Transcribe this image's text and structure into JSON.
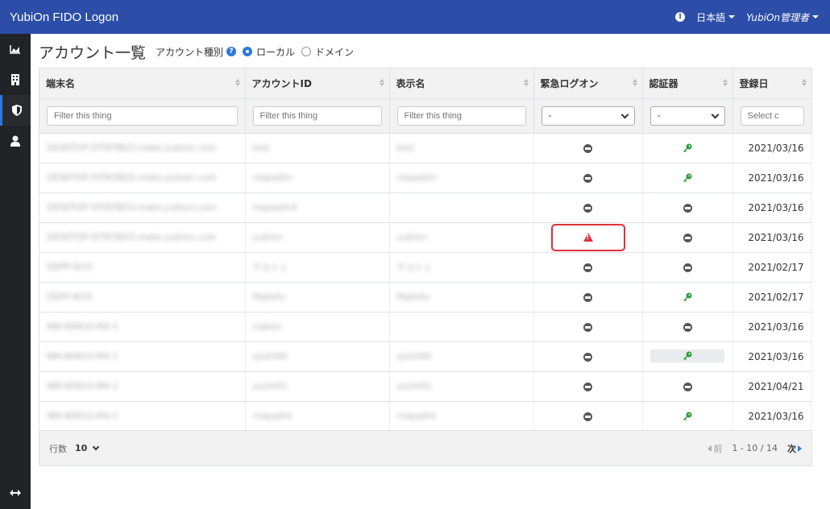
{
  "app": {
    "title": "YubiOn FIDO Logon"
  },
  "nav": {
    "language": "日本語",
    "user": "YubiOn管理者"
  },
  "sidebar": {
    "items": [
      {
        "icon": "chart-area-icon"
      },
      {
        "icon": "building-icon"
      },
      {
        "icon": "shield-icon",
        "active": true
      },
      {
        "icon": "user-icon"
      }
    ],
    "toggle_icon": "arrows-h-icon"
  },
  "page": {
    "title": "アカウント一覧",
    "account_type_label": "アカウント種別",
    "radio_local": "ローカル",
    "radio_domain": "ドメイン"
  },
  "table": {
    "headers": [
      "端末名",
      "アカウントID",
      "表示名",
      "緊急ログオン",
      "認証器",
      "登録日"
    ],
    "filter_placeholders": [
      "Filter this thing",
      "Filter this thing",
      "Filter this thing"
    ],
    "filter_select_values": [
      "-",
      "-"
    ],
    "date_placeholder": "Select c",
    "rows": [
      {
        "terminal": "DESKTOP-5ITNTBD3.mako.yubion.com",
        "account_id": "test",
        "display": "test",
        "emergency": "minus",
        "auth": "key",
        "date": "2021/03/16"
      },
      {
        "terminal": "DESKTOP-5ITNTBD3.mako.yubion.com",
        "account_id": "mapadm",
        "display": "mapadm",
        "emergency": "minus",
        "auth": "key",
        "date": "2021/03/16"
      },
      {
        "terminal": "DESKTOP-5ITNTBD3.mako.yubion.com",
        "account_id": "mapadm5",
        "display": "",
        "emergency": "minus",
        "auth": "minus",
        "date": "2021/03/16"
      },
      {
        "terminal": "DESKTOP-5ITNTBD3.mako.yubion.com",
        "account_id": "yubion",
        "display": "yubion",
        "emergency": "warning",
        "auth": "minus",
        "date": "2021/03/16"
      },
      {
        "terminal": "DEPP-W10",
        "account_id": "テスト１",
        "display": "テスト１",
        "emergency": "minus",
        "auth": "minus",
        "date": "2021/02/17"
      },
      {
        "terminal": "DEPP-W10",
        "account_id": "Makoto",
        "display": "Makoto",
        "emergency": "minus",
        "auth": "key",
        "date": "2021/02/17"
      },
      {
        "terminal": "NM-WIN10-M4-1",
        "account_id": "makos",
        "display": "",
        "emergency": "minus",
        "auth": "minus",
        "date": "2021/03/16"
      },
      {
        "terminal": "NM-WIN10-M4-1",
        "account_id": "yoshi00",
        "display": "yoshi00",
        "emergency": "minus",
        "auth": "key-highlight",
        "date": "2021/03/16"
      },
      {
        "terminal": "NM-WIN10-M4-1",
        "account_id": "yoshi01",
        "display": "yoshi01",
        "emergency": "minus",
        "auth": "minus",
        "date": "2021/04/21"
      },
      {
        "terminal": "NM-WIN10-M4-1",
        "account_id": "mapadm",
        "display": "mapadm",
        "emergency": "minus",
        "auth": "key",
        "date": "2021/03/16"
      }
    ]
  },
  "footer": {
    "rows_label": "行数",
    "rows_value": "10",
    "prev": "前",
    "range": "1 - 10 / 14",
    "next": "次"
  },
  "colors": {
    "navbar": "#2c4ea8",
    "sidebar": "#222326",
    "accent": "#2c78e0",
    "key": "#2e9e3a",
    "warning": "#d9363e"
  }
}
